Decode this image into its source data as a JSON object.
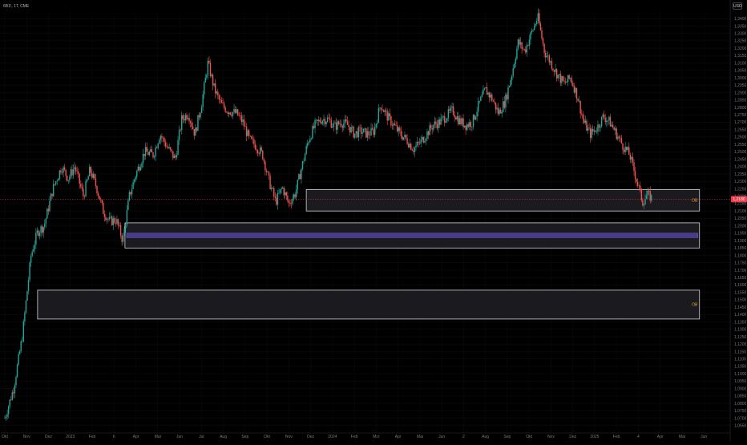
{
  "header": {
    "symbol": "6B1!, 1T, CME",
    "currency": "USD"
  },
  "colors": {
    "up": "#26a69a",
    "down": "#ef5350",
    "zone_border": "#d1d4dc",
    "zone_fill": "#1e1f24",
    "band": "#4a3a8c",
    "price_line": "#f23645",
    "label": "#f5a623"
  },
  "chart_data": {
    "type": "candlestick",
    "ylim": [
      1.06,
      1.345
    ],
    "y_ticks": [
      "1,3400",
      "1,3350",
      "1,3300",
      "1,3250",
      "1,3200",
      "1,3150",
      "1,3100",
      "1,3050",
      "1,3000",
      "1,2950",
      "1,2900",
      "1,2850",
      "1,2800",
      "1,2750",
      "1,2700",
      "1,2650",
      "1,2600",
      "1,2550",
      "1,2500",
      "1,2450",
      "1,2400",
      "1,2350",
      "1,2300",
      "1,2250",
      "1,2200",
      "1,2150",
      "1,2100",
      "1,2050",
      "1,2000",
      "1,1950",
      "1,1900",
      "1,1850",
      "1,1800",
      "1,1750",
      "1,1700",
      "1,1650",
      "1,1600",
      "1,1550",
      "1,1500",
      "1,1450",
      "1,1400",
      "1,1350",
      "1,1300",
      "1,1250",
      "1,1200",
      "1,1150",
      "1,1100",
      "1,1050",
      "1,1000",
      "1,0950",
      "1,0900",
      "1,0850",
      "1,0800",
      "1,0750",
      "1,0700",
      "1,0650"
    ],
    "x_labels": [
      "Okt",
      "Nov",
      "Dez",
      "2023",
      "Feb",
      "6",
      "Apr",
      "Mai",
      "Jun",
      "Jul",
      "Aug",
      "Sep",
      "Okt",
      "Nov",
      "Dez",
      "2024",
      "Feb",
      "Mrz",
      "Apr",
      "Mai",
      "Jun",
      "2",
      "Aug",
      "Sep",
      "Okt",
      "Nov",
      "Dez",
      "2025",
      "Feb",
      "4",
      "Apr",
      "Mai",
      "Jun"
    ],
    "x_tick_times": [
      0,
      1,
      2,
      3,
      4,
      5,
      6,
      7,
      8,
      9,
      10,
      11,
      12,
      13,
      14,
      15,
      16,
      17,
      18,
      19,
      20,
      21,
      22,
      23,
      24,
      25,
      26,
      27,
      28,
      29,
      30,
      31,
      32
    ],
    "x_range": [
      0,
      32.8
    ],
    "current_price": 1.218,
    "current_price_label": "1,2180",
    "path": [
      [
        0,
        1.07
      ],
      [
        0.4,
        1.09
      ],
      [
        0.8,
        1.125
      ],
      [
        1.2,
        1.18
      ],
      [
        1.5,
        1.196
      ],
      [
        1.8,
        1.2
      ],
      [
        2.2,
        1.225
      ],
      [
        2.6,
        1.24
      ],
      [
        2.9,
        1.232
      ],
      [
        3.2,
        1.24
      ],
      [
        3.6,
        1.22
      ],
      [
        3.9,
        1.238
      ],
      [
        4.2,
        1.226
      ],
      [
        4.5,
        1.21
      ],
      [
        4.8,
        1.203
      ],
      [
        5.1,
        1.204
      ],
      [
        5.4,
        1.19
      ],
      [
        5.7,
        1.22
      ],
      [
        6.0,
        1.235
      ],
      [
        6.4,
        1.25
      ],
      [
        6.8,
        1.248
      ],
      [
        7.1,
        1.262
      ],
      [
        7.4,
        1.254
      ],
      [
        7.8,
        1.245
      ],
      [
        8.1,
        1.272
      ],
      [
        8.4,
        1.276
      ],
      [
        8.7,
        1.262
      ],
      [
        9.0,
        1.282
      ],
      [
        9.3,
        1.31
      ],
      [
        9.6,
        1.292
      ],
      [
        9.9,
        1.282
      ],
      [
        10.2,
        1.278
      ],
      [
        10.6,
        1.276
      ],
      [
        10.9,
        1.27
      ],
      [
        11.2,
        1.258
      ],
      [
        11.5,
        1.254
      ],
      [
        11.8,
        1.248
      ],
      [
        12.1,
        1.23
      ],
      [
        12.4,
        1.216
      ],
      [
        12.7,
        1.226
      ],
      [
        13.0,
        1.215
      ],
      [
        13.3,
        1.222
      ],
      [
        13.6,
        1.24
      ],
      [
        13.9,
        1.258
      ],
      [
        14.2,
        1.268
      ],
      [
        14.5,
        1.272
      ],
      [
        14.8,
        1.272
      ],
      [
        15.1,
        1.267
      ],
      [
        15.4,
        1.27
      ],
      [
        15.7,
        1.268
      ],
      [
        16.0,
        1.262
      ],
      [
        16.3,
        1.264
      ],
      [
        16.6,
        1.262
      ],
      [
        16.9,
        1.264
      ],
      [
        17.2,
        1.282
      ],
      [
        17.5,
        1.274
      ],
      [
        17.8,
        1.268
      ],
      [
        18.1,
        1.262
      ],
      [
        18.4,
        1.258
      ],
      [
        18.7,
        1.252
      ],
      [
        19.0,
        1.256
      ],
      [
        19.3,
        1.262
      ],
      [
        19.6,
        1.268
      ],
      [
        19.9,
        1.27
      ],
      [
        20.2,
        1.274
      ],
      [
        20.5,
        1.278
      ],
      [
        20.8,
        1.271
      ],
      [
        21.1,
        1.268
      ],
      [
        21.4,
        1.27
      ],
      [
        21.7,
        1.282
      ],
      [
        22.0,
        1.292
      ],
      [
        22.3,
        1.286
      ],
      [
        22.6,
        1.276
      ],
      [
        22.9,
        1.284
      ],
      [
        23.2,
        1.302
      ],
      [
        23.5,
        1.324
      ],
      [
        23.8,
        1.318
      ],
      [
        24.1,
        1.33
      ],
      [
        24.4,
        1.341
      ],
      [
        24.7,
        1.318
      ],
      [
        25.0,
        1.31
      ],
      [
        25.3,
        1.302
      ],
      [
        25.6,
        1.296
      ],
      [
        25.9,
        1.3
      ],
      [
        26.2,
        1.288
      ],
      [
        26.5,
        1.27
      ],
      [
        26.8,
        1.262
      ],
      [
        27.1,
        1.266
      ],
      [
        27.4,
        1.274
      ],
      [
        27.7,
        1.27
      ],
      [
        28.0,
        1.262
      ],
      [
        28.3,
        1.254
      ],
      [
        28.6,
        1.248
      ],
      [
        28.9,
        1.232
      ],
      [
        29.2,
        1.216
      ],
      [
        29.4,
        1.221
      ],
      [
        29.6,
        1.219
      ]
    ],
    "zones": [
      {
        "t1": 13.8,
        "t2": 31.8,
        "top": 1.2245,
        "bottom": 1.21,
        "label": "OB"
      },
      {
        "t1": 5.5,
        "t2": 31.8,
        "top": 1.202,
        "bottom": 1.185,
        "label": "",
        "band_top": 1.195,
        "band_bottom": 1.192
      },
      {
        "t1": 1.5,
        "t2": 31.8,
        "top": 1.1565,
        "bottom": 1.137,
        "label": "OB"
      }
    ]
  }
}
